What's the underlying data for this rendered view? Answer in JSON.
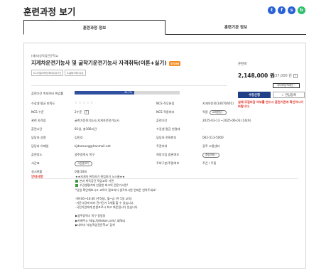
{
  "page_title": "훈련과정 보기",
  "share": [
    {
      "icon": "twitter-icon",
      "glyph": "t",
      "color": "#2a62d5"
    },
    {
      "icon": "facebook-icon",
      "glyph": "f",
      "color": "#2a62d5"
    },
    {
      "icon": "kakaostory-icon",
      "glyph": "s",
      "color": "#2a62d5"
    },
    {
      "icon": "blog-icon",
      "glyph": "b",
      "color": "#2fbf6f"
    }
  ],
  "tabs": {
    "course": "훈련과정 정보",
    "institution": "훈련기관 정보"
  },
  "course": {
    "institution": "(재)대성직업전문학교",
    "title": "지게차운전기능사 및 굴착기운전기능사 자격취득(이론+실기)",
    "badge": "추천과정",
    "tags": [
      "K-디지털크레딧/최대수강기간",
      "K-클래스에서수강"
    ],
    "price_label": "훈련비",
    "price": "2,148,000 원",
    "original_price": "537,000 원",
    "self_pay_btn": "자비부담액계산 ›",
    "apply_btn": "수강신청",
    "fav_btn": "☆ 관심등록",
    "warning": "실제 모집마감 여부를 반드시 훈련기관에 확인하시기 바랍니다."
  },
  "details": {
    "employment_label": "훈련기간 빅데이터 취업률",
    "employment_value": "56.7%",
    "employment_fraction": 0.567,
    "satisfaction_label": "수강생 평균 만족도",
    "stars": "☆☆☆☆☆",
    "ncs_code_label": "NCS 직무분류",
    "ncs_code": "지게차운전(14070401)",
    "ncs_level_label": "NCS 수준",
    "ncs_level": "2수준",
    "ncs_std_label": "NCS 적용여부",
    "ncs_std": "적용",
    "ncs_std_chip": "교과편성 ›",
    "type_label": "관련 자격증",
    "type_value": "굴착기운전기능사,지게차운전기능사",
    "period_label": "훈련기간",
    "period_value": "2025-03-13 ~2025-06-03 (1회차)",
    "hours_label": "훈련시간",
    "hours_value": "81일, 총308시간",
    "quota_label": "수강생 평균 연령대",
    "quota_value": "-",
    "manager_label": "담당자 성명",
    "manager_value": "김민호",
    "tel_label": "담당자 전화번호",
    "tel_value": "062-513-5000",
    "email_label": "담당자 이메일",
    "email_value": "kjdaesung@hanmail.net",
    "region_label": "주관부처",
    "region_value": "광주 고용센터",
    "place_label": "훈련장소",
    "place_value": "광주광역시 북구",
    "apply_label": "희망기업 참관여부",
    "apply_chip": "훈련과정 ›",
    "schedule_label": "시간표",
    "schedule_chip": "시간표보기",
    "weekday_label": "주야구분/주말여부",
    "weekday_value": "주간 / 주중",
    "capacity_label": "실시현황",
    "capacity_value": "0명/10회"
  },
  "notice": {
    "label": "안내사항",
    "lines": [
      "★★지게차 취득하기 취업하기 노스쿨★★",
      "본과 취득공단 직업교육 기관",
      "수강생평가에 친절한 최고의 전문가시면!",
      "*당일 확인해보시고 교육이 필요하다 생각하시면 언제든 연락주세요!",
      "",
      "-09:00~16:40 (주5일), 월~금 (주 5일 교육)",
      "-기준시장에 따라 전기단가 1개월 할 수 있습니다.",
      "-국민기업에게 만원프로시 최고 화운됩니다 있습니다.",
      "",
      "▶광주광역시 북구 동림동",
      "▶카페주소 http://jdlokoe.com/_djfdoj",
      "▶네이버 '대성직업전문학교' 검색"
    ]
  }
}
